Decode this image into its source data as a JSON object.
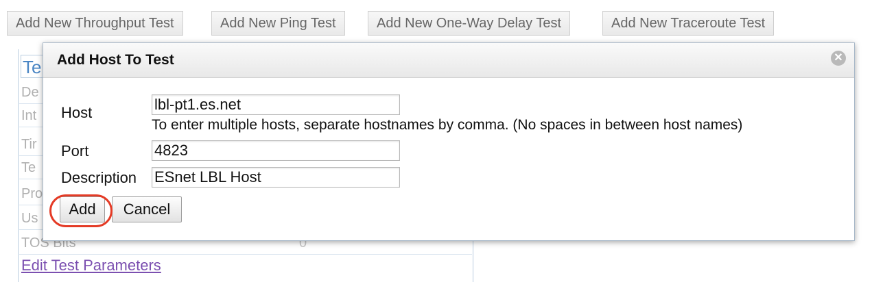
{
  "toolbar": {
    "buttons": [
      "Add New Throughput Test",
      "Add New Ping Test",
      "Add New One-Way Delay Test",
      "Add New Traceroute Test"
    ]
  },
  "background_panel": {
    "title": "Te",
    "rows": [
      {
        "label": "De",
        "value": ""
      },
      {
        "label": "Int",
        "value": ""
      },
      {
        "label": "Tir",
        "value": ""
      },
      {
        "label": "Te",
        "value": ""
      },
      {
        "label": "Pro",
        "value": ""
      },
      {
        "label": "Us",
        "value": ""
      },
      {
        "label": "TOS Bits",
        "value": "0"
      }
    ],
    "edit_link": "Edit Test Parameters"
  },
  "dialog": {
    "title": "Add Host To Test",
    "close_icon": "close-icon",
    "host_label": "Host",
    "host_value": "lbl-pt1.es.net",
    "host_hint": "To enter multiple hosts, separate hostnames by comma. (No spaces in between host names)",
    "port_label": "Port",
    "port_value": "4823",
    "description_label": "Description",
    "description_value": "ESnet LBL Host",
    "add_label": "Add",
    "cancel_label": "Cancel"
  },
  "colors": {
    "highlight_ring": "#e43b26",
    "panel_title": "#4a86c5",
    "link": "#7b4fb0"
  }
}
